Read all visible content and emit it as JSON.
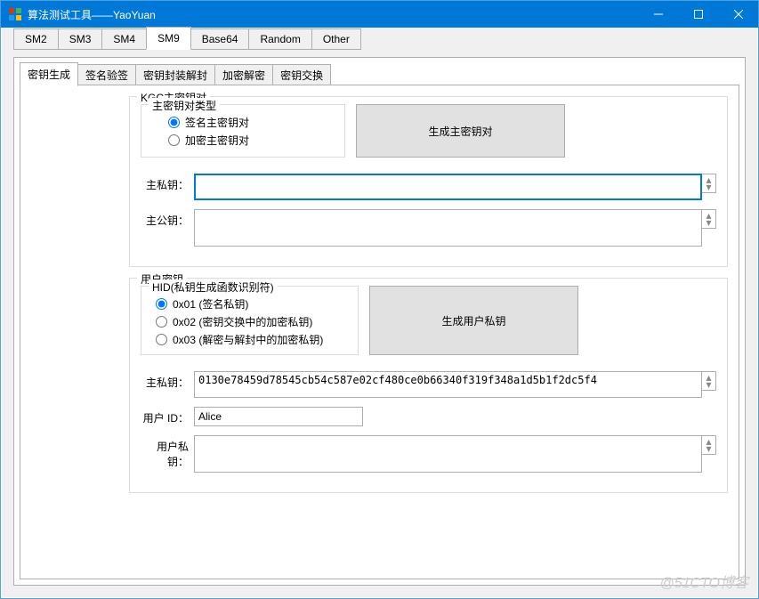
{
  "window": {
    "title": "算法测试工具——YaoYuan"
  },
  "main_tabs": [
    "SM2",
    "SM3",
    "SM4",
    "SM9",
    "Base64",
    "Random",
    "Other"
  ],
  "main_tabs_active": 3,
  "sub_tabs": [
    "密钥生成",
    "签名验签",
    "密钥封装解封",
    "加密解密",
    "密钥交换"
  ],
  "sub_tabs_active": 0,
  "kgc": {
    "group_label": "KGC主密钥对",
    "type_group_label": "主密钥对类型",
    "radio_sign": "签名主密钥对",
    "radio_enc": "加密主密钥对",
    "type_selected": "sign",
    "gen_button": "生成主密钥对",
    "master_priv_label": "主私钥：",
    "master_priv_value": "",
    "master_pub_label": "主公钥：",
    "master_pub_value": ""
  },
  "user": {
    "group_label": "用户密钥",
    "hid_group_label": "HID(私钥生成函数识别符)",
    "hid_opt1": "0x01 (签名私钥)",
    "hid_opt2": "0x02 (密钥交换中的加密私钥)",
    "hid_opt3": "0x03 (解密与解封中的加密私钥)",
    "hid_selected": "0x01",
    "gen_button": "生成用户私钥",
    "master_priv_label": "主私钥：",
    "master_priv_value": "0130e78459d78545cb54c587e02cf480ce0b66340f319f348a1d5b1f2dc5f4",
    "user_id_label": "用户 ID：",
    "user_id_value": "Alice",
    "user_priv_label": "用户私钥：",
    "user_priv_value": ""
  },
  "watermark": "@51CTO博客"
}
